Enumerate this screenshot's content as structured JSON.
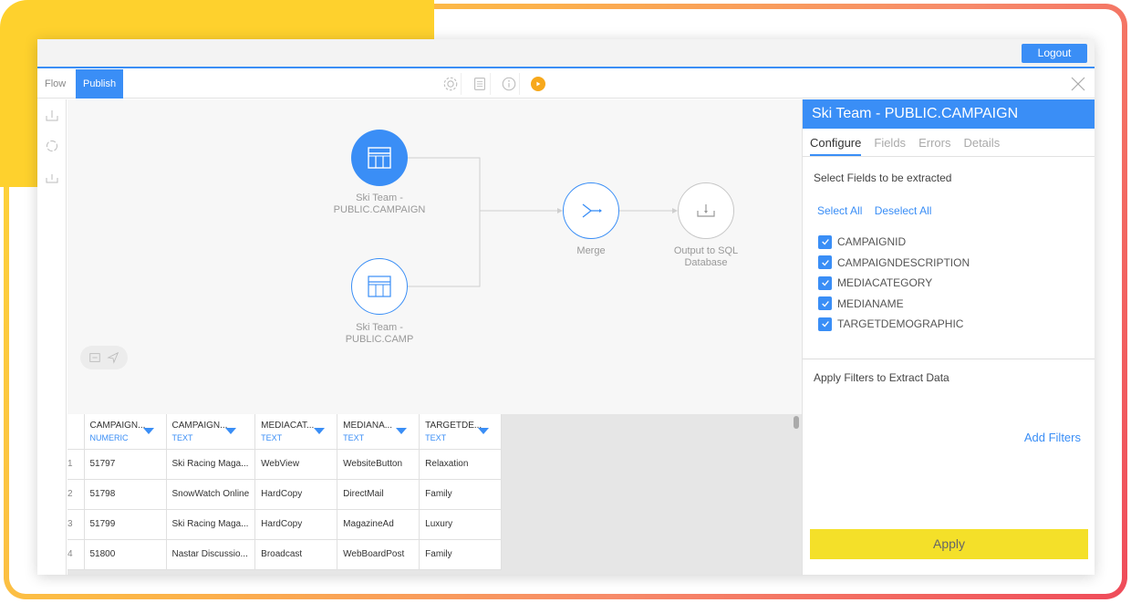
{
  "header": {
    "logout_label": "Logout"
  },
  "toolbar": {
    "tabs": [
      {
        "label": "Flow"
      },
      {
        "label": "Publish"
      }
    ],
    "icons": [
      "settings-icon",
      "document-icon",
      "info-icon",
      "run-icon",
      "close-icon"
    ]
  },
  "side_tools": [
    "upload-icon",
    "refresh-icon",
    "download-icon"
  ],
  "flow": {
    "nodes": [
      {
        "label_line1": "Ski Team -",
        "label_line2": "PUBLIC.CAMPAIGN"
      },
      {
        "label_line1": "Ski Team -",
        "label_line2": "PUBLIC.CAMP"
      },
      {
        "label_line1": "Merge",
        "label_line2": ""
      },
      {
        "label_line1": "Output to SQL",
        "label_line2": "Database"
      }
    ]
  },
  "grid": {
    "columns": [
      {
        "name": "CAMPAIGN...",
        "type": "NUMERIC"
      },
      {
        "name": "CAMPAIGN...",
        "type": "TEXT"
      },
      {
        "name": "MEDIACAT...",
        "type": "TEXT"
      },
      {
        "name": "MEDIANA...",
        "type": "TEXT"
      },
      {
        "name": "TARGETDE...",
        "type": "TEXT"
      }
    ],
    "rows": [
      {
        "num": "1",
        "cells": [
          "51797",
          "Ski Racing Maga...",
          "WebView",
          "WebsiteButton",
          "Relaxation"
        ]
      },
      {
        "num": "2",
        "cells": [
          "51798",
          "SnowWatch Online",
          "HardCopy",
          "DirectMail",
          "Family"
        ]
      },
      {
        "num": "3",
        "cells": [
          "51799",
          "Ski Racing Maga...",
          "HardCopy",
          "MagazineAd",
          "Luxury"
        ]
      },
      {
        "num": "4",
        "cells": [
          "51800",
          "Nastar Discussio...",
          "Broadcast",
          "WebBoardPost",
          "Family"
        ]
      }
    ]
  },
  "panel": {
    "title": "Ski Team - PUBLIC.CAMPAIGN",
    "tabs": [
      {
        "label": "Configure"
      },
      {
        "label": "Fields"
      },
      {
        "label": "Errors"
      },
      {
        "label": "Details"
      }
    ],
    "select_fields_title": "Select Fields to be extracted",
    "select_all": "Select All",
    "deselect_all": "Deselect All",
    "fields": [
      {
        "label": "CAMPAIGNID",
        "checked": true
      },
      {
        "label": "CAMPAIGNDESCRIPTION",
        "checked": true
      },
      {
        "label": "MEDIACATEGORY",
        "checked": true
      },
      {
        "label": "MEDIANAME",
        "checked": true
      },
      {
        "label": "TARGETDEMOGRAPHIC",
        "checked": true
      }
    ],
    "filters_title": "Apply Filters to Extract Data",
    "add_filters": "Add Filters",
    "apply_label": "Apply"
  },
  "colors": {
    "accent": "#3a8ef6",
    "apply": "#f4e029",
    "run": "#f7a81b",
    "frame_yellow": "#fed12d"
  }
}
